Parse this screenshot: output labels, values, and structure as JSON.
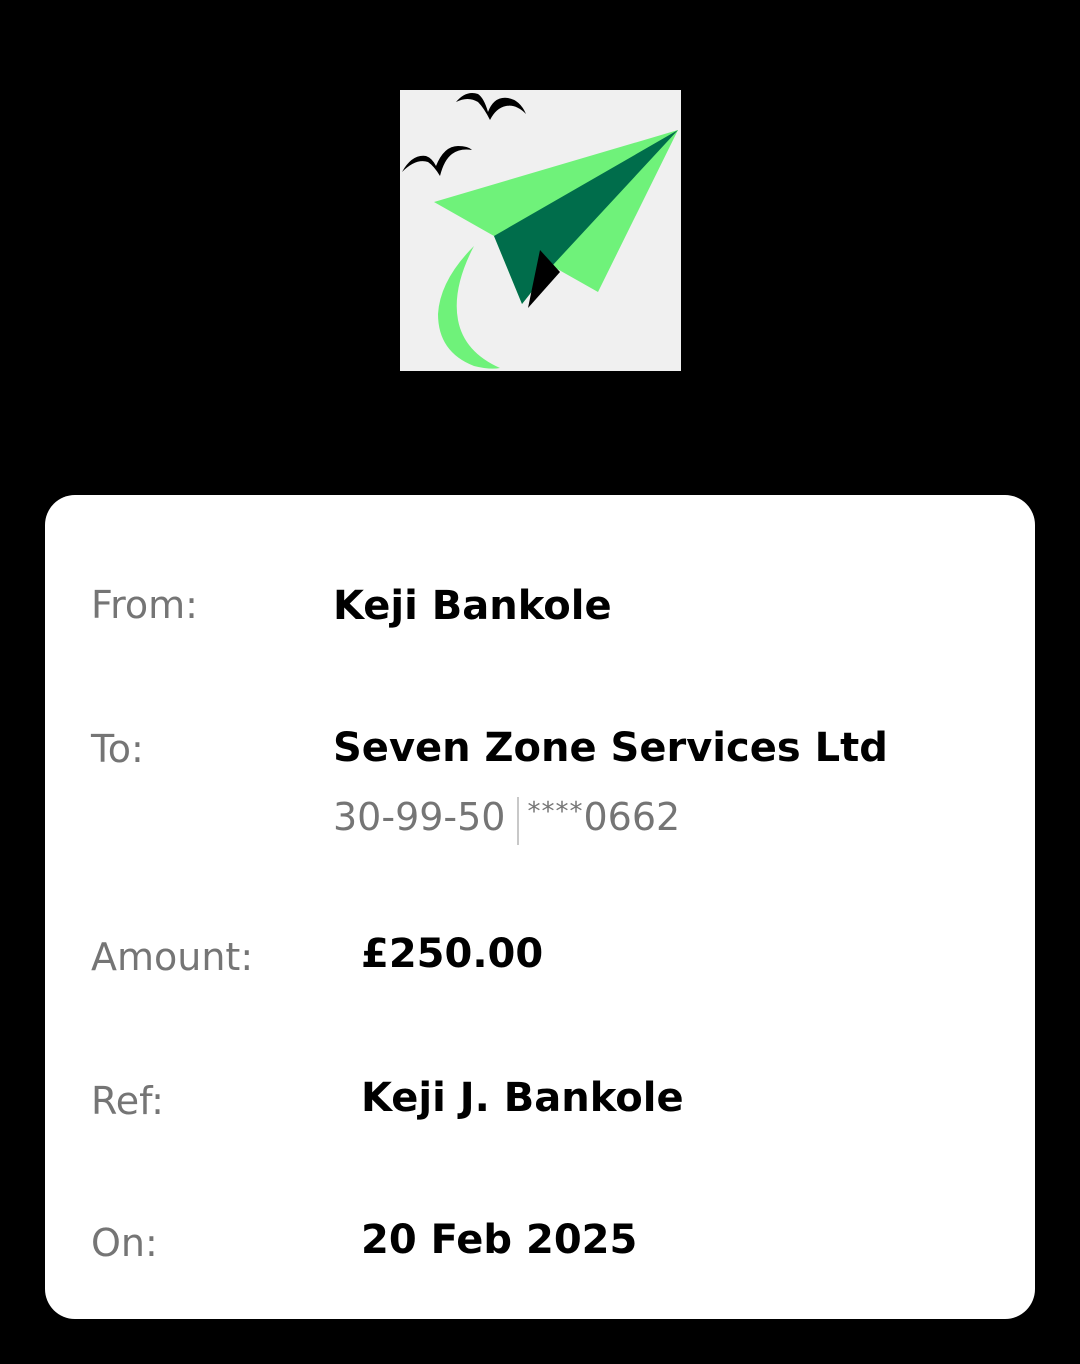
{
  "logo": {
    "icon": "paper-plane-logo",
    "colors": {
      "background": "#f0f0f0",
      "light_green": "#6ff27a",
      "dark_green": "#006d4b",
      "black": "#000000"
    }
  },
  "details": {
    "from": {
      "label": "From:",
      "value": "Keji Bankole"
    },
    "to": {
      "label": "To:",
      "value": "Seven Zone Services Ltd",
      "sort_code": "30-99-50",
      "account_mask": "****",
      "account_last4": "0662"
    },
    "amount": {
      "label": "Amount:",
      "value": "£250.00"
    },
    "ref": {
      "label": "Ref:",
      "value": "Keji J. Bankole"
    },
    "on": {
      "label": "On:",
      "value": "20 Feb 2025"
    }
  }
}
